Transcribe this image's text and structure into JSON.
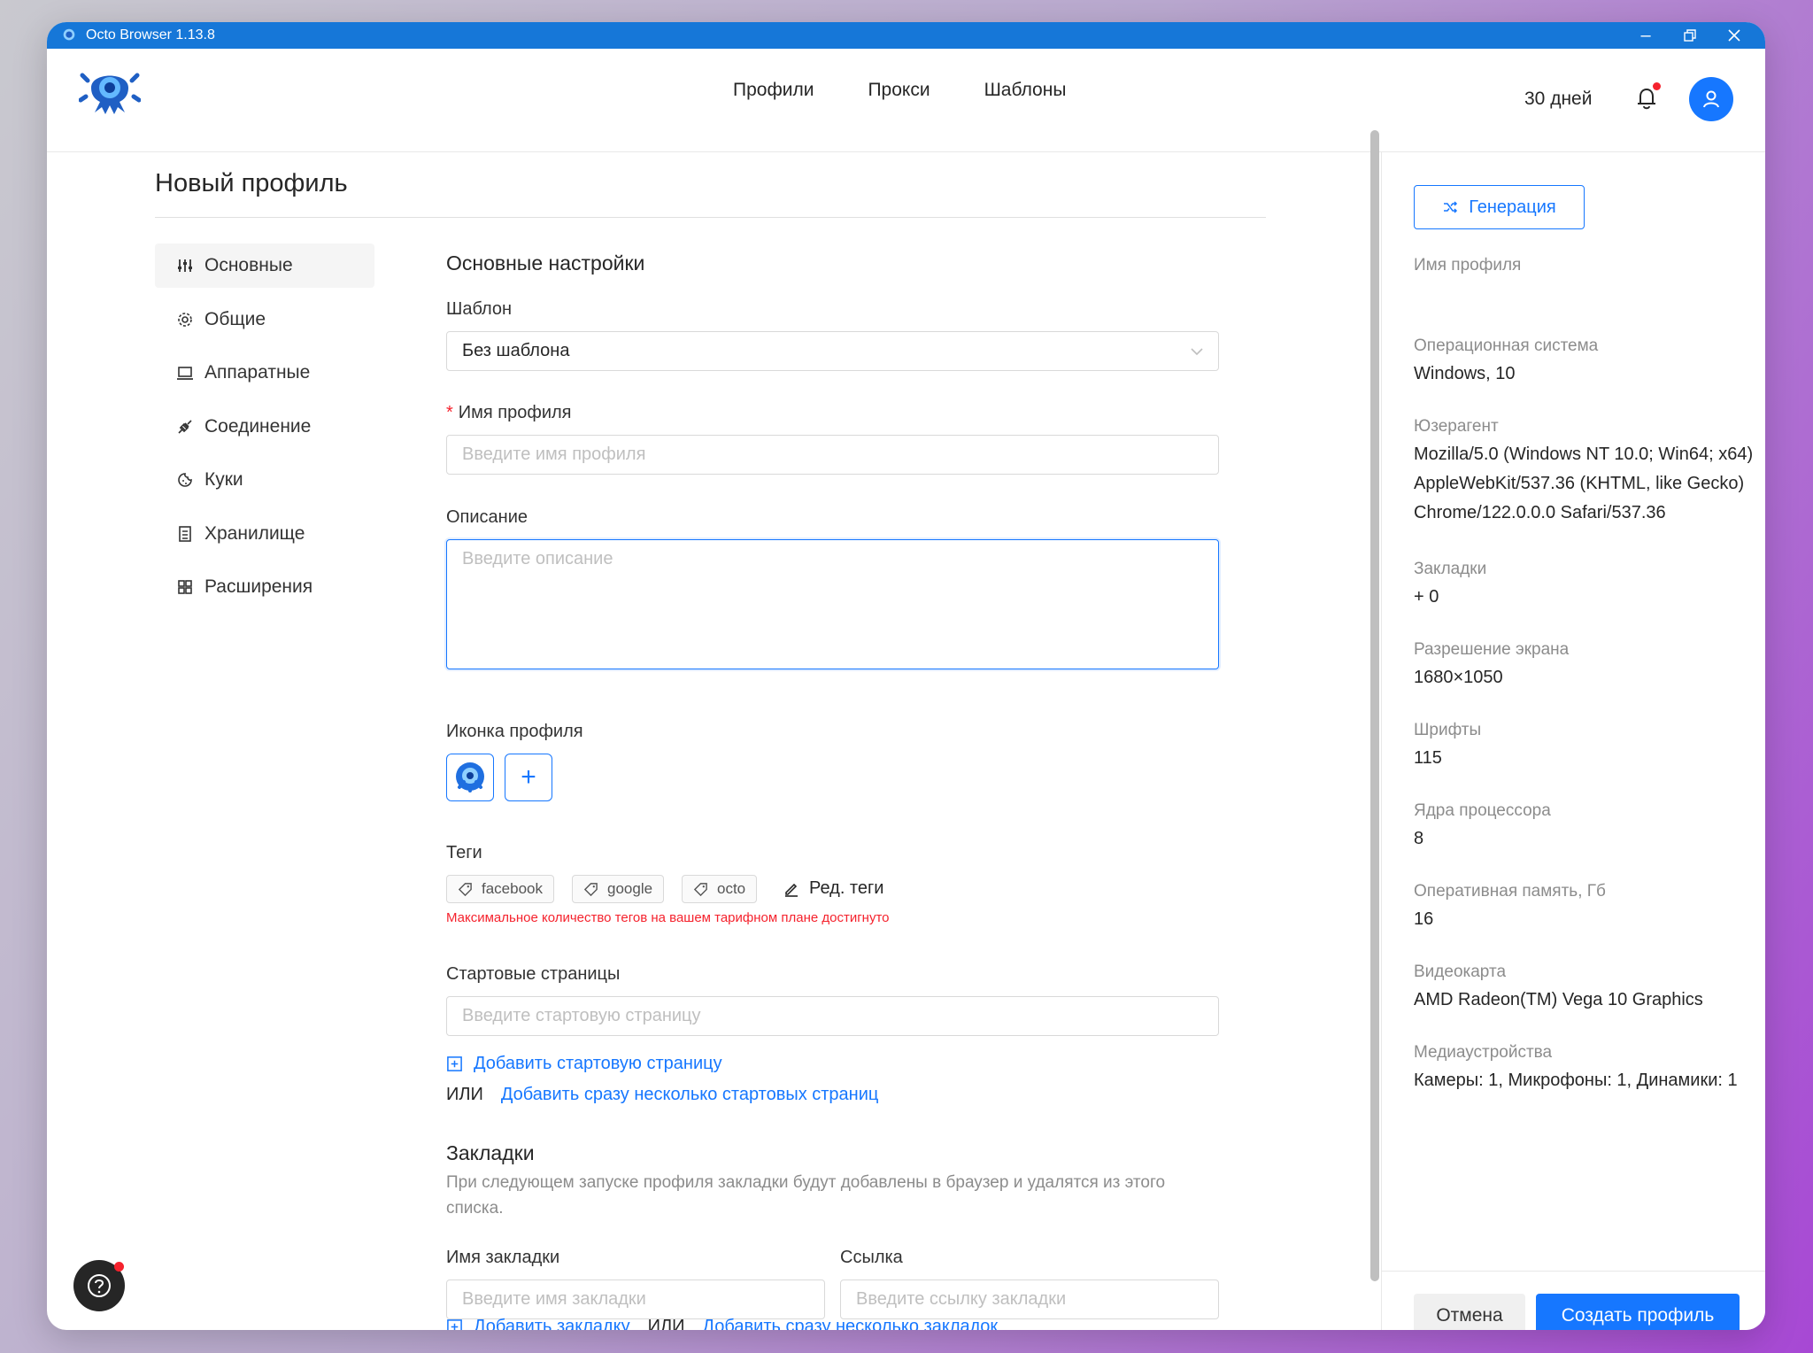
{
  "window": {
    "title": "Octo Browser 1.13.8"
  },
  "nav": {
    "links": [
      "Профили",
      "Прокси",
      "Шаблоны"
    ],
    "subscription": "30 дней"
  },
  "page": {
    "title": "Новый профиль"
  },
  "sidemenu": {
    "items": [
      {
        "label": "Основные",
        "icon": "sliders-icon"
      },
      {
        "label": "Общие",
        "icon": "gear-icon"
      },
      {
        "label": "Аппаратные",
        "icon": "laptop-icon"
      },
      {
        "label": "Соединение",
        "icon": "plug-icon"
      },
      {
        "label": "Куки",
        "icon": "cookie-icon"
      },
      {
        "label": "Хранилище",
        "icon": "storage-icon"
      },
      {
        "label": "Расширения",
        "icon": "grid-icon"
      }
    ]
  },
  "form": {
    "section_title": "Основные настройки",
    "template_label": "Шаблон",
    "template_value": "Без шаблона",
    "name_required_mark": "*",
    "name_label": "Имя профиля",
    "name_placeholder": "Введите имя профиля",
    "description_label": "Описание",
    "description_placeholder": "Введите описание",
    "icon_label": "Иконка профиля",
    "add_icon": "+",
    "tags_label": "Теги",
    "tags": [
      "facebook",
      "google",
      "octo"
    ],
    "edit_tags": "Ред. теги",
    "tags_warning": "Максимальное количество тегов на вашем тарифном плане достигнуто",
    "start_pages_label": "Стартовые страницы",
    "start_page_placeholder": "Введите стартовую страницу",
    "add_start_page": "Добавить стартовую страницу",
    "or": "ИЛИ",
    "add_many_start_pages": "Добавить сразу несколько стартовых страниц",
    "bookmarks_title": "Закладки",
    "bookmarks_desc": "При следующем запуске профиля закладки будут добавлены в браузер и удалятся из этого списка.",
    "bookmark_name_label": "Имя закладки",
    "bookmark_name_placeholder": "Введите имя закладки",
    "bookmark_link_label": "Ссылка",
    "bookmark_link_placeholder": "Введите ссылку закладки",
    "add_bookmark": "Добавить закладку",
    "add_many_bookmarks": "Добавить сразу несколько закладок"
  },
  "summary": {
    "generate": "Генерация",
    "profile_name_label": "Имя профиля",
    "os_label": "Операционная система",
    "os_value": "Windows, 10",
    "ua_label": "Юзерагент",
    "ua_value": "Mozilla/5.0 (Windows NT 10.0; Win64; x64) AppleWebKit/537.36 (KHTML, like Gecko) Chrome/122.0.0.0 Safari/537.36",
    "bookmarks_label": "Закладки",
    "bookmarks_value": "+ 0",
    "resolution_label": "Разрешение экрана",
    "resolution_value": "1680×1050",
    "fonts_label": "Шрифты",
    "fonts_value": "115",
    "cpu_label": "Ядра процессора",
    "cpu_value": "8",
    "ram_label": "Оперативная память, Гб",
    "ram_value": "16",
    "gpu_label": "Видеокарта",
    "gpu_value": "AMD Radeon(TM) Vega 10 Graphics",
    "media_label": "Медиаустройства",
    "media_value": "Камеры: 1, Микрофоны: 1, Динамики: 1"
  },
  "footer": {
    "cancel": "Отмена",
    "create": "Создать профиль"
  },
  "colors": {
    "accent": "#1677ff",
    "titlebar": "#1677d8",
    "error": "#f5222d"
  }
}
